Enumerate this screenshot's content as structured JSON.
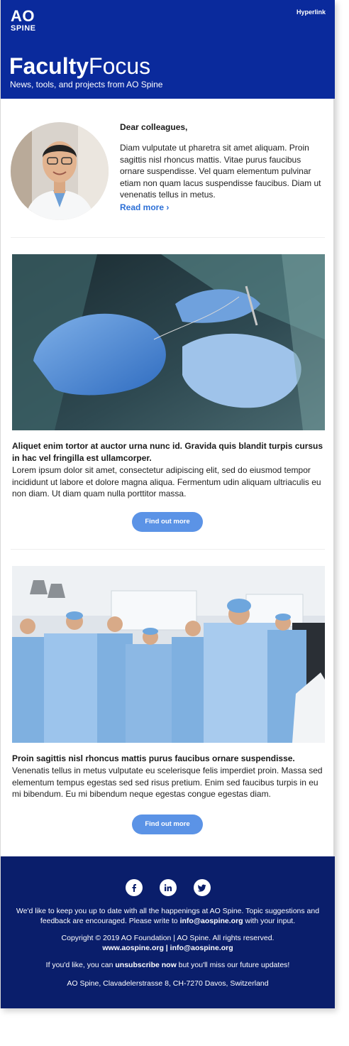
{
  "header": {
    "logo_ao": "AO",
    "logo_spine": "SPINE",
    "hyperlink": "Hyperlink",
    "title_bold": "Faculty",
    "title_light": "Focus",
    "subtitle": "News, tools, and projects from AO Spine"
  },
  "intro": {
    "greeting": "Dear colleagues,",
    "body": "Diam vulputate ut pharetra sit amet aliquam. Proin sagittis nisl rhoncus mattis. Vitae purus faucibus ornare suspendisse. Vel quam elementum pulvinar etiam non quam lacus suspendisse faucibus. Diam ut venenatis tellus in metus.",
    "read_more": "Read more ›"
  },
  "articles": [
    {
      "title": "Aliquet enim tortor at auctor urna nunc id. Gravida quis blandit turpis cursus in hac vel fringilla est ullamcorper.",
      "body": "Lorem ipsum dolor sit amet, consectetur adipiscing elit, sed do eiusmod tempor incididunt ut labore et dolore magna aliqua. Fermentum udin aliquam ultriaculis eu non diam. Ut diam quam nulla porttitor massa.",
      "cta": "Find out more"
    },
    {
      "title": "Proin sagittis nisl rhoncus mattis purus faucibus ornare suspendisse.",
      "body": "Venenatis tellus in metus vulputate eu scelerisque felis imperdiet proin. Massa sed elementum tempus egestas sed sed risus pretium. Enim sed faucibus turpis in eu mi bibendum. Eu mi bibendum neque egestas congue egestas diam.",
      "cta": "Find out more"
    }
  ],
  "footer": {
    "social": [
      "facebook-icon",
      "linkedin-icon",
      "twitter-icon"
    ],
    "updates_text": "We'd like to keep you up to date with all the happenings at AO Spine. Topic suggestions and feedback are encouraged. Please write to ",
    "updates_email": "info@aospine.org",
    "updates_end": " with your input.",
    "copyright": "Copyright © 2019 AO Foundation | AO Spine. All rights reserved.",
    "website": "www.aospine.org",
    "separator": " | ",
    "email": "info@aospine.org",
    "unsub_pre": "If you'd like, you can ",
    "unsub_link": "unsubscribe now",
    "unsub_post": " but you'll miss our future updates!",
    "address": "AO Spine, Clavadelerstrasse 8, CH-7270 Davos, Switzerland"
  },
  "colors": {
    "header_bg": "#0a2a9c",
    "footer_bg": "#0a1e6b",
    "link": "#2c6fd6",
    "button": "#5b93e6"
  }
}
